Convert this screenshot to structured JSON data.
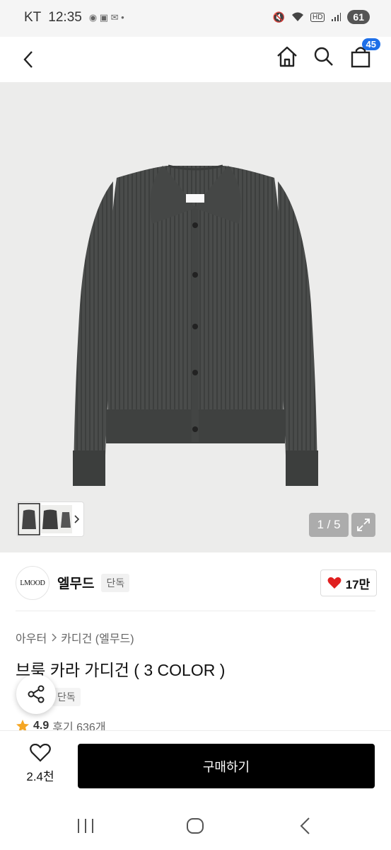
{
  "status_bar": {
    "carrier": "KT",
    "time": "12:35",
    "battery": "61"
  },
  "nav": {
    "cart_count": "45"
  },
  "gallery": {
    "counter": "1 / 5"
  },
  "brand": {
    "logo_text": "LMOOD",
    "name": "엘무드",
    "badge": "단독",
    "like_count": "17만"
  },
  "breadcrumb": {
    "level1": "아우터",
    "level2": "카디건 (엘무드)"
  },
  "product": {
    "title": "브룩 카라 가디건 ( 3 COLOR )",
    "badge": "단독",
    "rating": "4.9",
    "review_label": "후기 636개"
  },
  "action_bar": {
    "wish_count": "2.4천",
    "buy_label": "구매하기"
  },
  "colors": {
    "buy_button": "#000000",
    "cart_badge": "#1e6fe8",
    "heart": "#e02020",
    "star": "#f5a623"
  }
}
